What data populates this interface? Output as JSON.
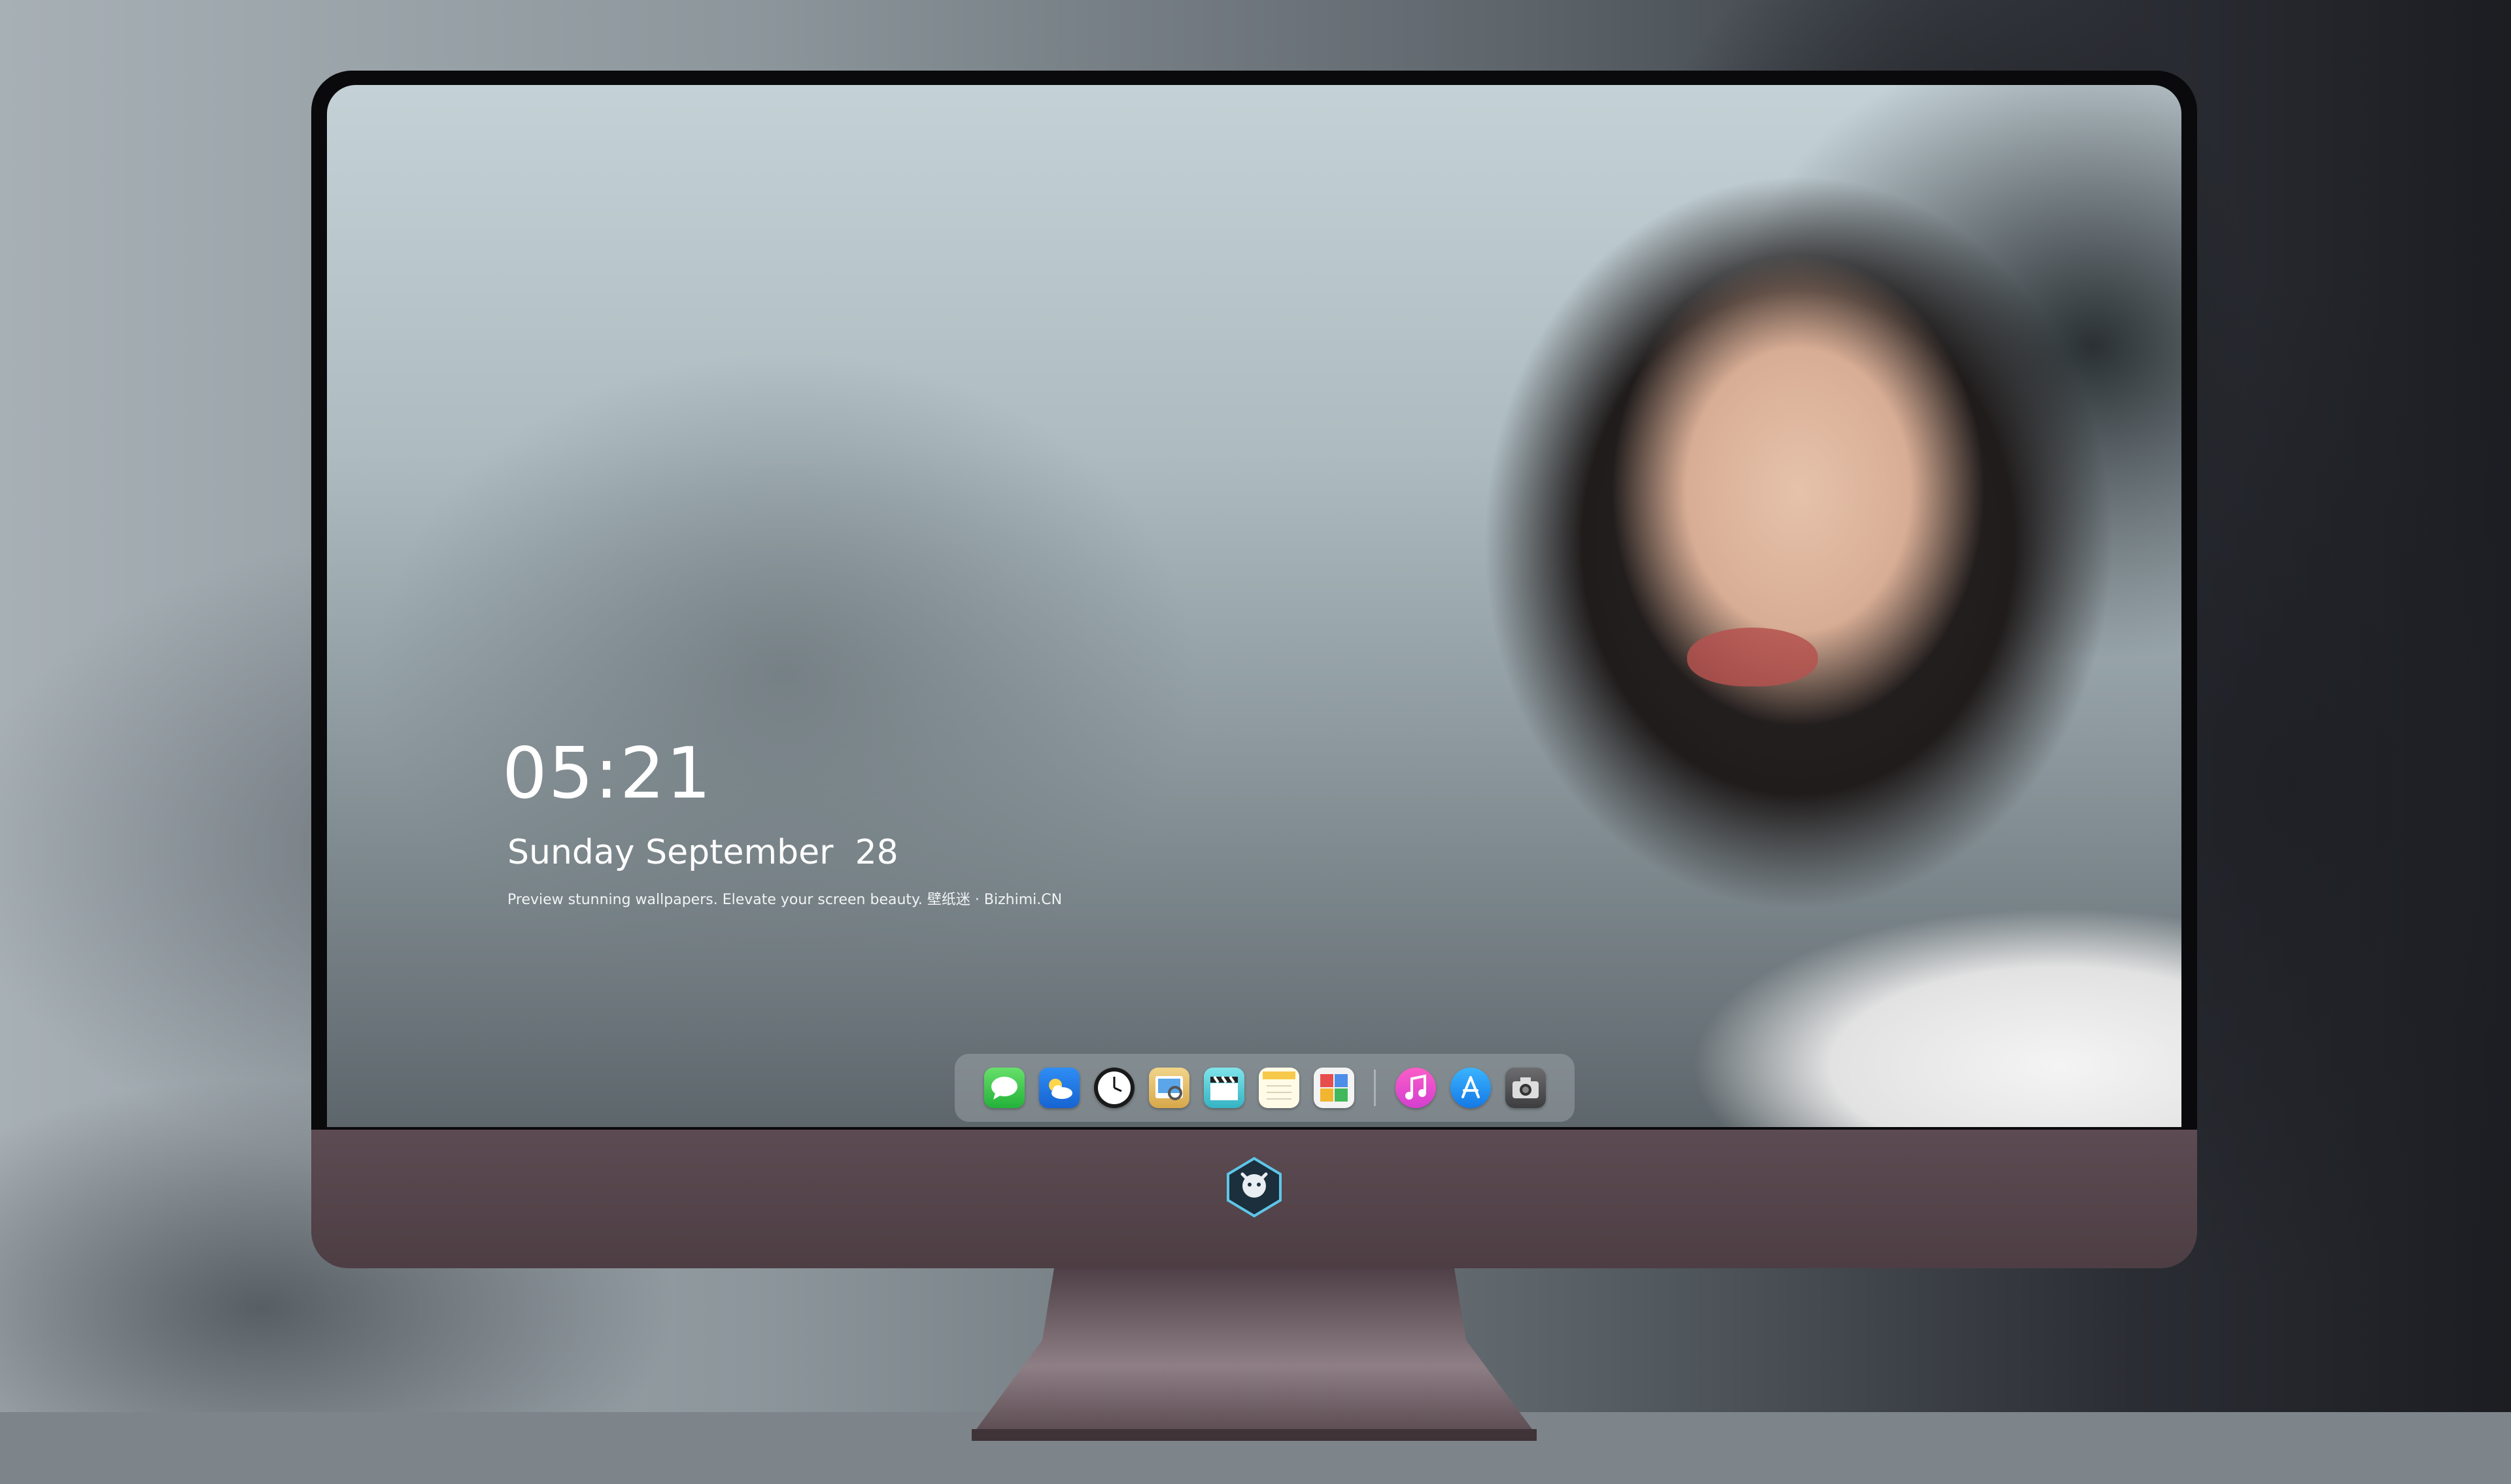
{
  "lockscreen": {
    "time": "05:21",
    "date": "Sunday September  28",
    "tagline": "Preview stunning wallpapers. Elevate your screen beauty. 壁纸迷 · Bizhimi.CN"
  },
  "dock": {
    "apps": [
      {
        "name": "Messages",
        "icon": "messages-icon"
      },
      {
        "name": "Weather",
        "icon": "weather-icon"
      },
      {
        "name": "Clock",
        "icon": "clock-icon"
      },
      {
        "name": "Preview",
        "icon": "preview-icon"
      },
      {
        "name": "Clips",
        "icon": "clapperboard-icon"
      },
      {
        "name": "Notes",
        "icon": "notes-icon"
      },
      {
        "name": "Photo Booth",
        "icon": "photo-grid-icon"
      },
      {
        "name": "Music",
        "icon": "music-icon"
      },
      {
        "name": "App Store",
        "icon": "app-store-icon"
      },
      {
        "name": "Camera",
        "icon": "camera-icon"
      }
    ]
  },
  "colors": {
    "chin": "#4d3e44",
    "bezel": "#0a0a0c",
    "dock_background": "rgba(210,214,218,0.28)"
  }
}
